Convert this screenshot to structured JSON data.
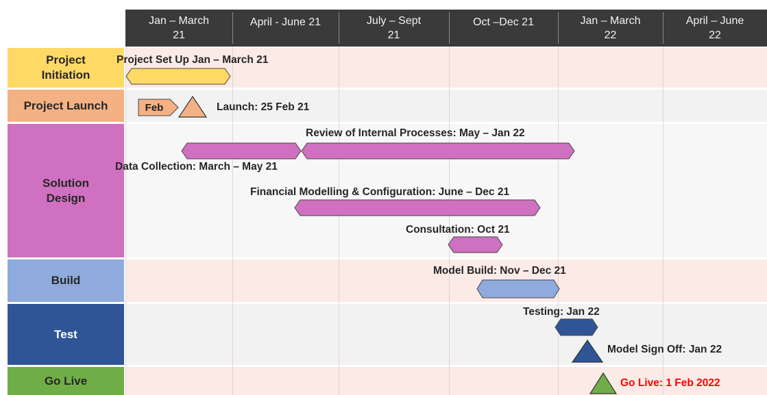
{
  "chart_data": {
    "type": "gantt",
    "periods": [
      "Jan – March\n21",
      "April - June 21",
      "July – Sept\n21",
      "Oct –Dec 21",
      "Jan – March\n22",
      "April – June\n22"
    ],
    "phases": [
      {
        "name": "Project\nInitiation",
        "color": "#ffd966"
      },
      {
        "name": "Project Launch",
        "color": "#f4b183"
      },
      {
        "name": "Solution\nDesign",
        "color": "#d070c0"
      },
      {
        "name": "Build",
        "color": "#8faadc"
      },
      {
        "name": "Test",
        "color": "#2f5597"
      },
      {
        "name": "Go Live",
        "color": "#70ad47"
      }
    ],
    "tasks": [
      {
        "label": "Project Set Up Jan – March 21",
        "start": "2021-01",
        "end": "2021-03",
        "phase": "Project\nInitiation"
      },
      {
        "label": "Review of Internal Processes: May – Jan 22",
        "start": "2021-05",
        "end": "2022-01",
        "phase": "Solution\nDesign"
      },
      {
        "label": "Data Collection: March – May 21",
        "start": "2021-03",
        "end": "2021-05",
        "phase": "Solution\nDesign"
      },
      {
        "label": "Financial Modelling & Configuration: June – Dec 21",
        "start": "2021-06",
        "end": "2021-12",
        "phase": "Solution\nDesign"
      },
      {
        "label": "Consultation: Oct 21",
        "start": "2021-10",
        "end": "2021-10",
        "phase": "Solution\nDesign"
      },
      {
        "label": "Model Build: Nov – Dec 21",
        "start": "2021-11",
        "end": "2021-12",
        "phase": "Build"
      },
      {
        "label": "Testing: Jan 22",
        "start": "2022-01",
        "end": "2022-01",
        "phase": "Test"
      }
    ],
    "milestones": [
      {
        "label": "Launch: 25 Feb 21",
        "date": "2021-02-25",
        "phase": "Project Launch",
        "color": "#f4b183",
        "marker_label": "Feb"
      },
      {
        "label": "Model Sign Off: Jan 22",
        "date": "2022-01",
        "phase": "Test",
        "color": "#2f5597"
      },
      {
        "label": "Go Live: 1 Feb 2022",
        "date": "2022-02-01",
        "phase": "Go Live",
        "color": "#70ad47",
        "label_color": "#ff0000"
      }
    ],
    "colors": {
      "header_bg": "#3a3a3a",
      "row_band_a": "#fbeae5",
      "row_band_b": "#f2f2f2"
    }
  }
}
